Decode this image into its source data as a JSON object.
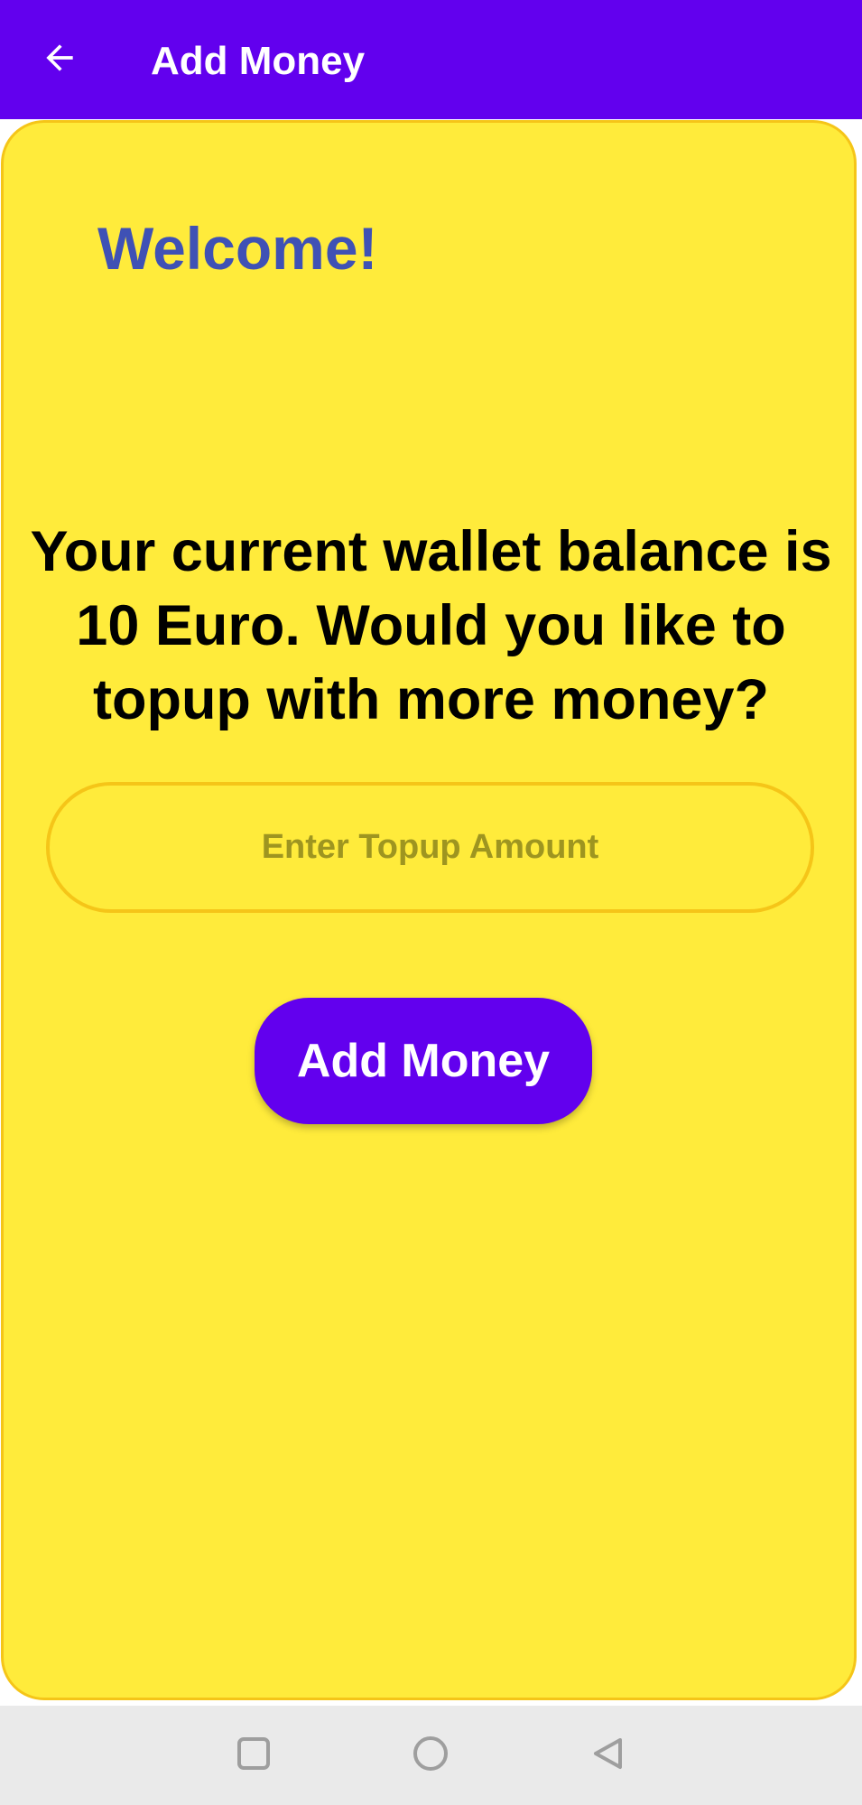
{
  "app_bar": {
    "title": "Add Money",
    "back_icon": "arrow-left-icon",
    "color": "#6200EE"
  },
  "main": {
    "welcome": "Welcome!",
    "balance_message": "Your current wallet balance is 10 Euro. Would you like to topup with more money?",
    "amount_input": {
      "placeholder": "Enter Topup Amount",
      "value": ""
    },
    "add_button_label": "Add Money",
    "card_color": "#FFEB3B",
    "accent_color": "#3F51B5"
  },
  "system_nav": {
    "recents_icon": "square-icon",
    "home_icon": "circle-icon",
    "back_icon": "triangle-back-icon"
  }
}
